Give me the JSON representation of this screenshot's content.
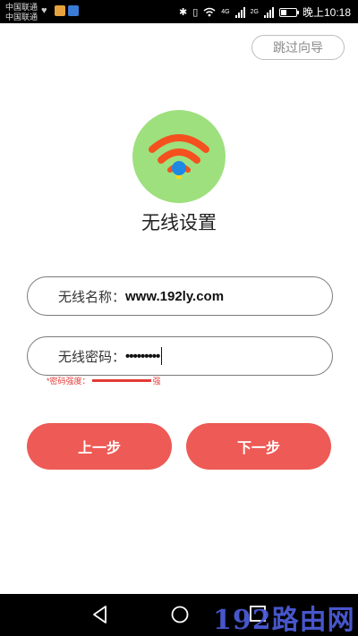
{
  "status_bar": {
    "carrier_1": "中国联通",
    "carrier_2": "中国联通",
    "network_1": "4G",
    "network_2": "2G",
    "time": "晚上10:18",
    "icons": [
      "heart-icon",
      "weibo-icon",
      "telegram-icon",
      "bluetooth-icon",
      "vibrate-icon",
      "wifi-icon",
      "signal-icon",
      "battery-icon"
    ]
  },
  "header": {
    "skip_label": "跳过向导"
  },
  "hero": {
    "icon": "wifi-icon",
    "title": "无线设置",
    "circle_color": "#9ee07e",
    "arc_color": "#f4511e",
    "dot_color": "#1e88e5"
  },
  "form": {
    "ssid_label": "无线名称：",
    "ssid_value": "www.192ly.com",
    "password_label": "无线密码：",
    "password_value": "•••••••••",
    "strength_label": "*密码强度：",
    "strength_value": "强",
    "strength_color": "#e53935"
  },
  "buttons": {
    "prev_label": "上一步",
    "next_label": "下一步",
    "color": "#ee5a55"
  },
  "nav_bar": {
    "icons": [
      "back-icon",
      "home-icon",
      "recent-apps-icon"
    ],
    "watermark": "192路由网"
  }
}
